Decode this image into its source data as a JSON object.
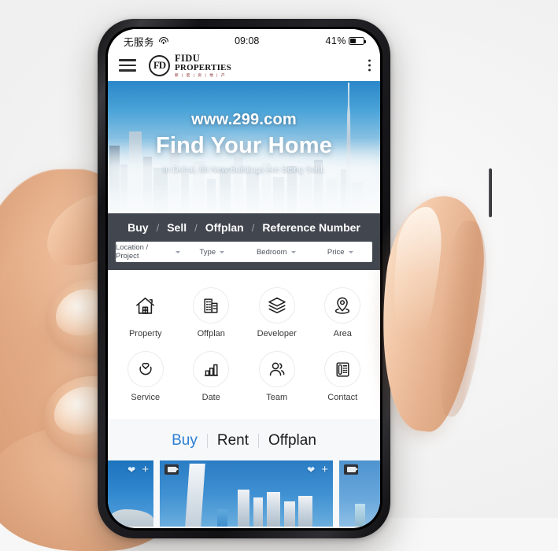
{
  "status_bar": {
    "carrier": "无服务",
    "wifi_icon": "wifi-icon",
    "time": "09:08",
    "battery_percent": "41%",
    "battery_level": 41
  },
  "app_header": {
    "menu_icon": "hamburger-menu-icon",
    "logo": {
      "monogram": "FD",
      "line1": "FIDU",
      "line2": "PROPERTIES",
      "line3": "菲 | 度 | 房 | 地 | 产"
    },
    "overflow_icon": "kebab-menu-icon"
  },
  "hero": {
    "url": "www.299.com",
    "headline": "Find Your Home",
    "subtitle": "In Dubai, 86 New Buildings Are Being Sold."
  },
  "nav_tabs": {
    "items": [
      "Buy",
      "Sell",
      "Offplan",
      "Reference Number"
    ],
    "separator": "/"
  },
  "search_filters": [
    {
      "label": "Location / Project",
      "icon": "chevron-down-icon"
    },
    {
      "label": "Type",
      "icon": "chevron-down-icon"
    },
    {
      "label": "Bedroom",
      "icon": "chevron-down-icon"
    },
    {
      "label": "Price",
      "icon": "chevron-down-icon"
    }
  ],
  "icon_grid": {
    "row1": [
      {
        "label": "Property",
        "icon": "house-icon"
      },
      {
        "label": "Offplan",
        "icon": "buildings-icon"
      },
      {
        "label": "Developer",
        "icon": "layers-icon"
      },
      {
        "label": "Area",
        "icon": "map-pin-icon"
      }
    ],
    "row2": [
      {
        "label": "Service",
        "icon": "heart-in-hands-icon"
      },
      {
        "label": "Date",
        "icon": "bar-chart-icon"
      },
      {
        "label": "Team",
        "icon": "people-icon"
      },
      {
        "label": "Contact",
        "icon": "desk-phone-icon"
      }
    ]
  },
  "listing_tabs": {
    "items": [
      "Buy",
      "Rent",
      "Offplan"
    ],
    "active": "Buy"
  },
  "property_cards": [
    {
      "favorite_icon": "heart-icon",
      "add_icon": "plus-icon",
      "video_icon": null
    },
    {
      "favorite_icon": "heart-icon",
      "add_icon": "plus-icon",
      "video_icon": "video-camera-icon"
    },
    {
      "favorite_icon": null,
      "add_icon": null,
      "video_icon": "video-camera-icon"
    }
  ],
  "colors": {
    "accent_blue": "#2a7fd4",
    "navbar": "#41464f",
    "hero_sky": "#2a87c8",
    "card_blue": "#2e7fc2"
  }
}
